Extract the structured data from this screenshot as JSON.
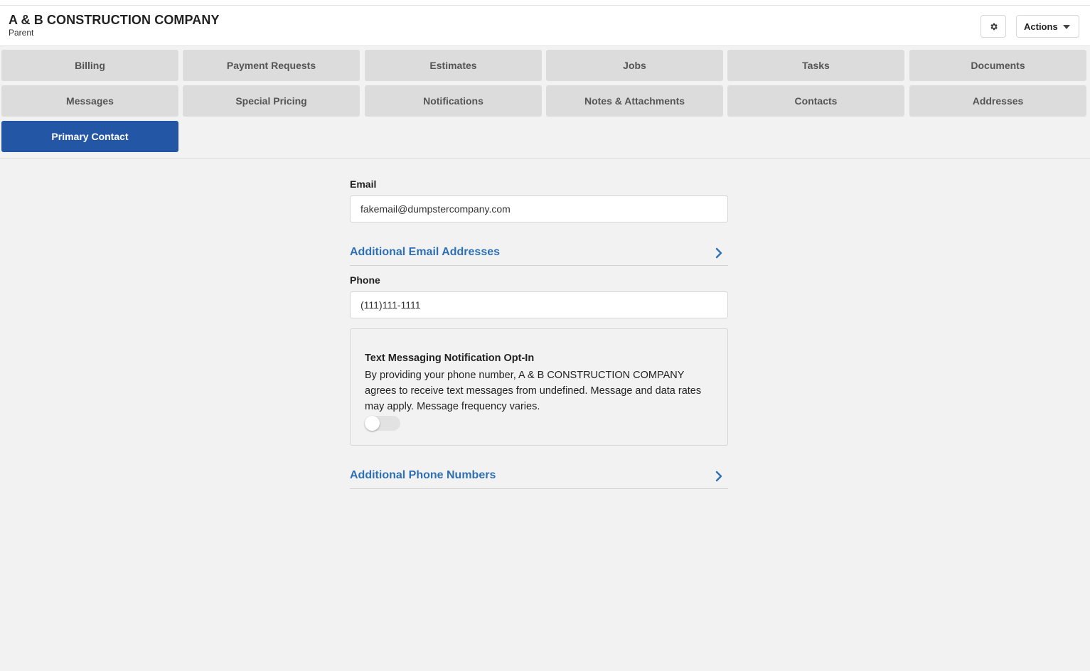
{
  "header": {
    "company_name": "A & B CONSTRUCTION COMPANY",
    "subtitle": "Parent",
    "settings_icon": "gear-icon",
    "actions_label": "Actions"
  },
  "tabs": [
    {
      "label": "Billing",
      "active": false
    },
    {
      "label": "Payment Requests",
      "active": false
    },
    {
      "label": "Estimates",
      "active": false
    },
    {
      "label": "Jobs",
      "active": false
    },
    {
      "label": "Tasks",
      "active": false
    },
    {
      "label": "Documents",
      "active": false
    },
    {
      "label": "Messages",
      "active": false
    },
    {
      "label": "Special Pricing",
      "active": false
    },
    {
      "label": "Notifications",
      "active": false
    },
    {
      "label": "Notes & Attachments",
      "active": false
    },
    {
      "label": "Contacts",
      "active": false
    },
    {
      "label": "Addresses",
      "active": false
    },
    {
      "label": "Primary Contact",
      "active": true
    }
  ],
  "form": {
    "email_label": "Email",
    "email_value": "fakemail@dumpstercompany.com",
    "additional_emails_label": "Additional Email Addresses",
    "phone_label": "Phone",
    "phone_value": "(111)111-1111",
    "optin": {
      "title": "Text Messaging Notification Opt-In",
      "text": "By providing your phone number, A & B CONSTRUCTION COMPANY agrees to receive text messages from undefined. Message and data rates may apply. Message frequency varies.",
      "enabled": false
    },
    "additional_phones_label": "Additional Phone Numbers"
  },
  "colors": {
    "accent": "#2456a6",
    "link": "#2f6fb3",
    "tab_bg": "#dcdcdc",
    "page_bg": "#f2f2f2"
  }
}
